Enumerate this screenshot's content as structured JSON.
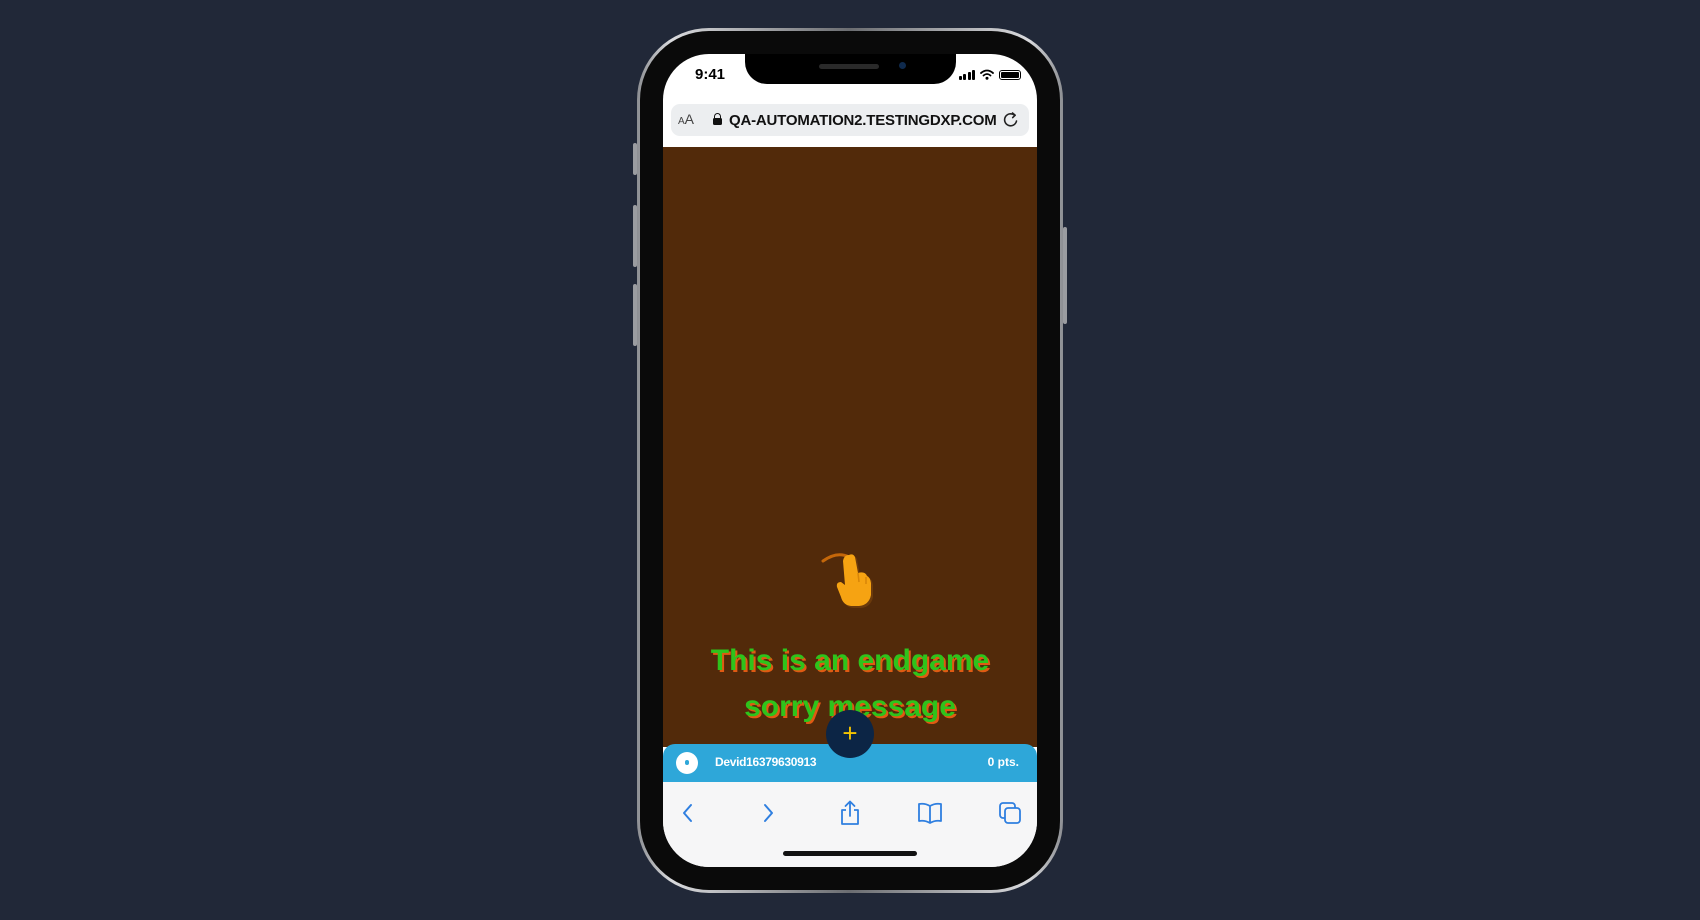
{
  "status_bar": {
    "time": "9:41"
  },
  "browser": {
    "text_size_label": "AA",
    "url": "QA-AUTOMATION2.TESTINGDXP.COM"
  },
  "game": {
    "background_color": "#522a0a",
    "message_line1": "This is an endgame",
    "message_line2": "sorry message",
    "message_color": "#2ec31b",
    "message_shadow_color": "#e05a12",
    "gesture_icon": "tap-hand-icon"
  },
  "footer": {
    "username": "Devid16379630913",
    "points": "0 pts.",
    "fab_label": "+",
    "bar_color": "#2ea7d9"
  },
  "toolbar": {
    "icons": [
      "back-icon",
      "forward-icon",
      "share-icon",
      "bookmarks-icon",
      "tabs-icon"
    ]
  }
}
